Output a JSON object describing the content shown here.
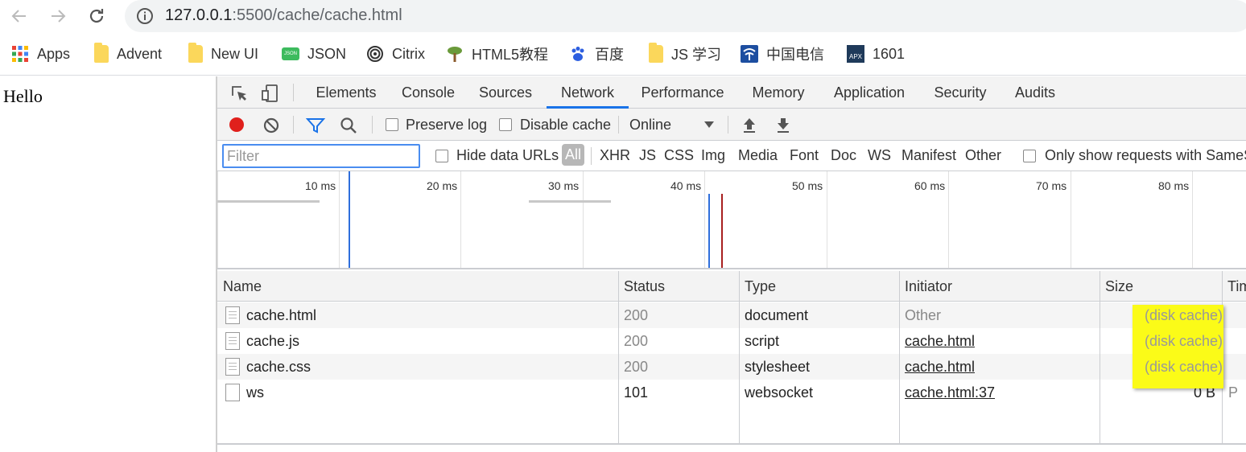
{
  "browser": {
    "url_host": "127.0.0.1",
    "url_path": ":5500/cache/cache.html"
  },
  "bookmarks": [
    {
      "label": "Apps",
      "icon": "apps-grid-icon"
    },
    {
      "label": "Advent",
      "icon": "folder-icon"
    },
    {
      "label": "New UI",
      "icon": "folder-icon"
    },
    {
      "label": "JSON",
      "icon": "json-icon"
    },
    {
      "label": "Citrix",
      "icon": "citrix-icon"
    },
    {
      "label": "HTML5教程",
      "icon": "tree-icon"
    },
    {
      "label": "百度",
      "icon": "baidu-paw-icon"
    },
    {
      "label": "JS 学习",
      "icon": "folder-icon"
    },
    {
      "label": "中国电信",
      "icon": "china-telecom-icon"
    },
    {
      "label": "1601",
      "icon": "apx-icon"
    }
  ],
  "json_icon_text": "JSON",
  "apx_icon_text": "APX",
  "page": {
    "hello": "Hello"
  },
  "devtools": {
    "tabs": [
      "Elements",
      "Console",
      "Sources",
      "Network",
      "Performance",
      "Memory",
      "Application",
      "Security",
      "Audits"
    ],
    "active_tab": "Network",
    "toolbar": {
      "preserve_log": "Preserve log",
      "disable_cache": "Disable cache",
      "throttle": "Online"
    },
    "filter": {
      "placeholder": "Filter",
      "hide_data_urls": "Hide data URLs",
      "types": [
        "All",
        "XHR",
        "JS",
        "CSS",
        "Img",
        "Media",
        "Font",
        "Doc",
        "WS",
        "Manifest",
        "Other"
      ],
      "samesite": "Only show requests with SameS"
    },
    "overview": {
      "ticks": [
        "10 ms",
        "20 ms",
        "30 ms",
        "40 ms",
        "50 ms",
        "60 ms",
        "70 ms",
        "80 ms"
      ]
    },
    "table": {
      "columns": [
        "Name",
        "Status",
        "Type",
        "Initiator",
        "Size",
        "Tim"
      ],
      "rows": [
        {
          "name": "cache.html",
          "status": "200",
          "type": "document",
          "initiator": "Other",
          "size": "(disk cache)",
          "time": ""
        },
        {
          "name": "cache.js",
          "status": "200",
          "type": "script",
          "initiator": "cache.html",
          "size": "(disk cache)",
          "time": ""
        },
        {
          "name": "cache.css",
          "status": "200",
          "type": "stylesheet",
          "initiator": "cache.html",
          "size": "(disk cache)",
          "time": ""
        },
        {
          "name": "ws",
          "status": "101",
          "type": "websocket",
          "initiator": "cache.html:37",
          "size": "0 B",
          "time": "P"
        }
      ]
    },
    "colors": {
      "record": "#e0201c",
      "accent": "#1a73e8",
      "highlight": "#fbfb18"
    }
  }
}
